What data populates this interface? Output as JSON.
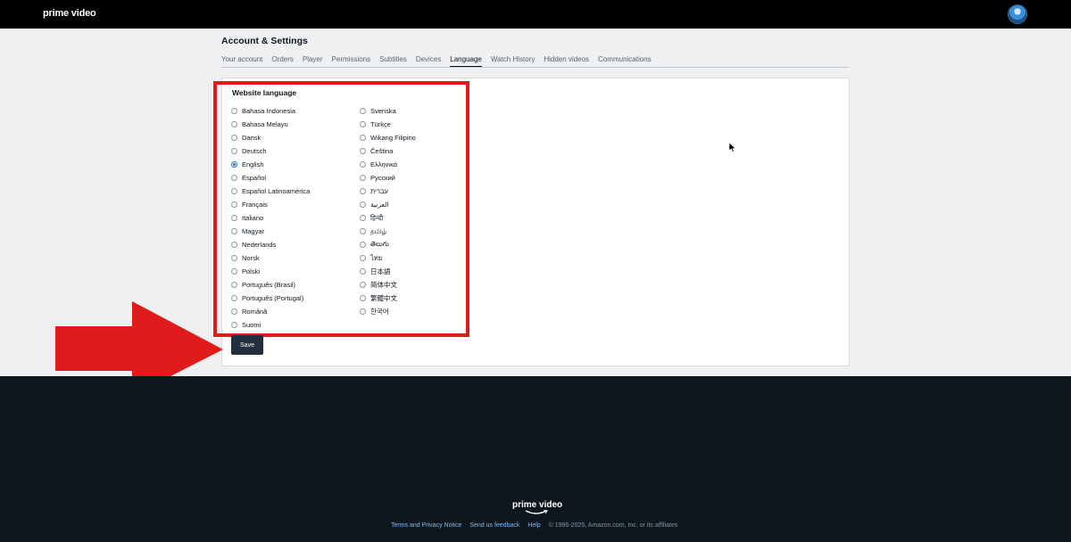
{
  "app": {
    "logo": "prime video"
  },
  "header": {
    "title": "Account & Settings"
  },
  "tabs": [
    {
      "label": "Your account"
    },
    {
      "label": "Orders"
    },
    {
      "label": "Player"
    },
    {
      "label": "Permissions"
    },
    {
      "label": "Subtitles"
    },
    {
      "label": "Devices"
    },
    {
      "label": "Language"
    },
    {
      "label": "Watch History"
    },
    {
      "label": "Hidden videos"
    },
    {
      "label": "Communications"
    }
  ],
  "active_tab": "Language",
  "language_section": {
    "title": "Website language",
    "selected": "English",
    "left_options": [
      {
        "label": "Bahasa Indonesia"
      },
      {
        "label": "Bahasa Melayu"
      },
      {
        "label": "Dansk"
      },
      {
        "label": "Deutsch"
      },
      {
        "label": "English"
      },
      {
        "label": "Español"
      },
      {
        "label": "Español Latinoamérica"
      },
      {
        "label": "Français"
      },
      {
        "label": "Italiano"
      },
      {
        "label": "Magyar"
      },
      {
        "label": "Nederlands"
      },
      {
        "label": "Norsk"
      },
      {
        "label": "Polski"
      },
      {
        "label": "Português (Brasil)"
      },
      {
        "label": "Português (Portugal)"
      },
      {
        "label": "Română"
      },
      {
        "label": "Suomi"
      }
    ],
    "right_options": [
      {
        "label": "Svenska"
      },
      {
        "label": "Türkçe"
      },
      {
        "label": "Wikang Filipino"
      },
      {
        "label": "Čeština"
      },
      {
        "label": "Ελληνικά"
      },
      {
        "label": "Русский"
      },
      {
        "label": "עברית"
      },
      {
        "label": "العربية"
      },
      {
        "label": "हिन्दी"
      },
      {
        "label": "தமிழ்"
      },
      {
        "label": "తెలుగు"
      },
      {
        "label": "ไทย"
      },
      {
        "label": "日本語"
      },
      {
        "label": "简体中文"
      },
      {
        "label": "繁體中文"
      },
      {
        "label": "한국어"
      }
    ],
    "save_label": "Save"
  },
  "footer": {
    "logo": "prime video",
    "links": [
      "Terms and Privacy Notice",
      "Send us feedback",
      "Help"
    ],
    "copyright": "© 1996-2025, Amazon.com, Inc. or its affiliates"
  },
  "colors": {
    "accent": "#1f73d1",
    "highlight": "#e01b1b",
    "button_bg": "#232f3e",
    "footer_bg": "#0f171e"
  }
}
